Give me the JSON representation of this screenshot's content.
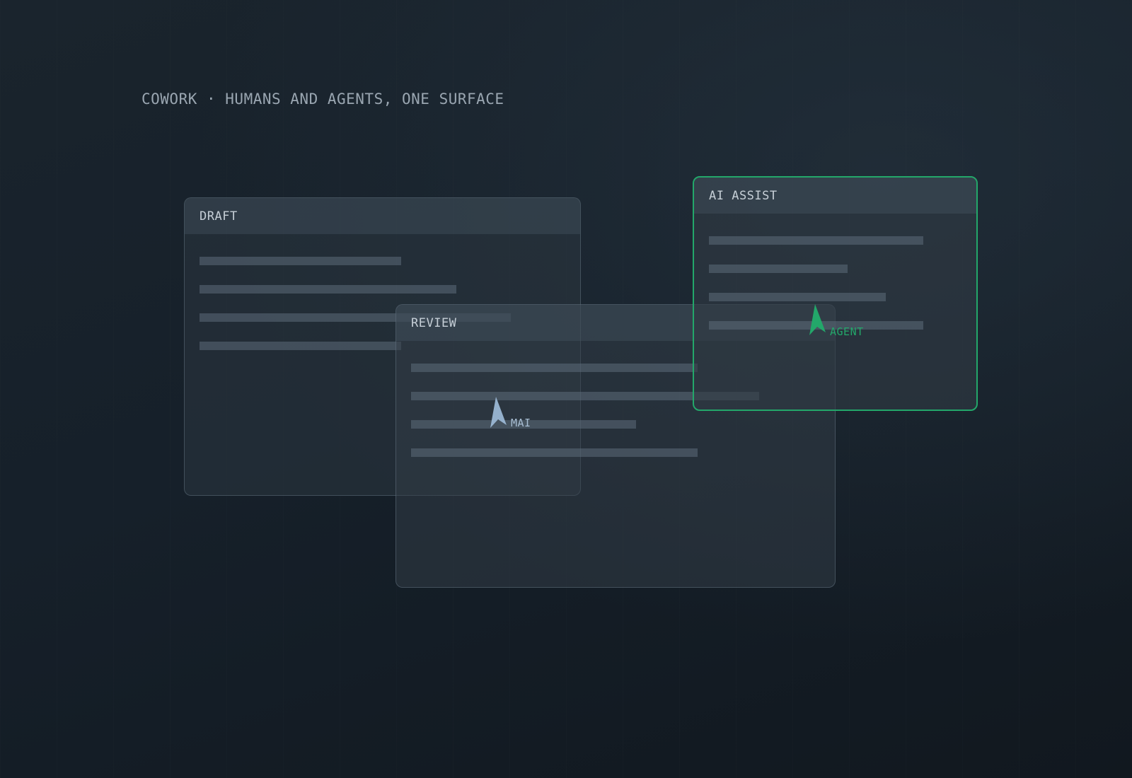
{
  "headline": "COWORK · HUMANS AND AGENTS, ONE SURFACE",
  "colors": {
    "background": "#16202a",
    "agent_accent": "#23a76a",
    "human_cursor": "#9dbbd8"
  },
  "panels": {
    "draft": {
      "title": "DRAFT"
    },
    "review": {
      "title": "REVIEW"
    },
    "assist": {
      "title": "AI ASSIST"
    }
  },
  "cursors": {
    "human": {
      "label": "MAI",
      "icon": "cursor-arrow-icon"
    },
    "agent": {
      "label": "AGENT",
      "icon": "cursor-arrow-icon"
    }
  }
}
